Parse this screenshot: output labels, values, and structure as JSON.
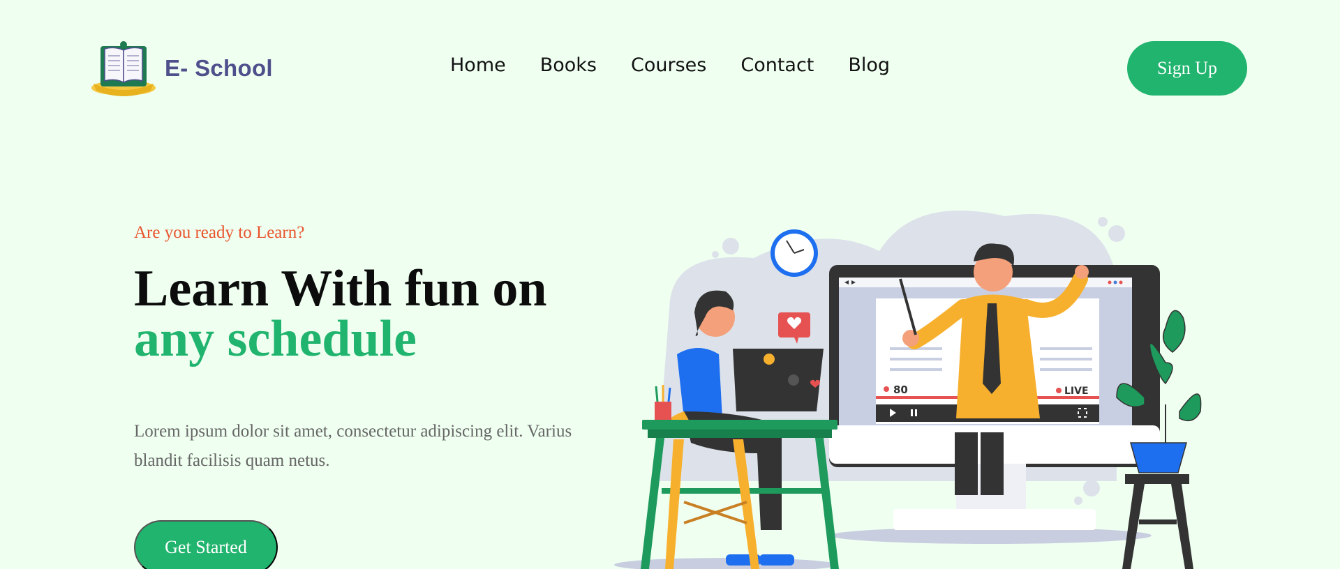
{
  "header": {
    "brand": "E- School",
    "nav": [
      "Home",
      "Books",
      "Courses",
      "Contact",
      "Blog"
    ],
    "signup_label": "Sign Up"
  },
  "hero": {
    "eyebrow": "Are you ready to Learn?",
    "title_line1": "Learn With fun on",
    "title_line2": "any schedule",
    "description": "Lorem ipsum dolor sit amet, consectetur adipiscing elit. Varius blandit facilisis quam netus.",
    "cta_label": "Get Started"
  },
  "illustration": {
    "viewer_count": "80",
    "live_label": "LIVE"
  },
  "colors": {
    "background": "#effff0",
    "accent": "#21b46e",
    "eyebrow": "#e9542e",
    "brand": "#4f4f8c"
  }
}
